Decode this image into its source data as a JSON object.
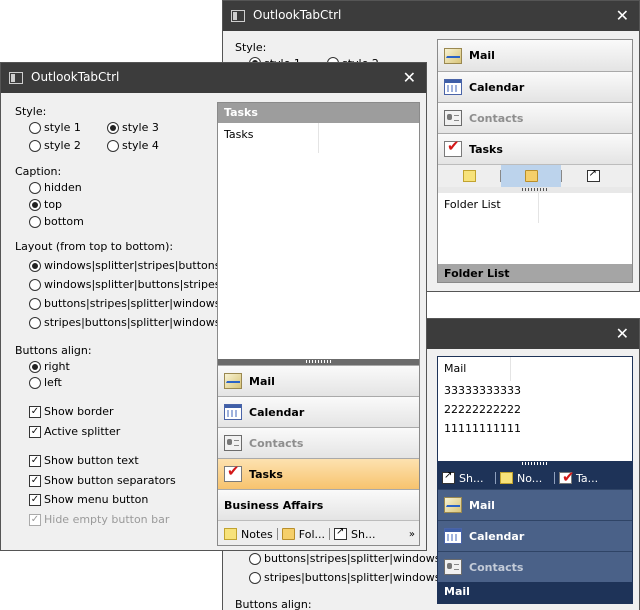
{
  "app_title": "OutlookTabCtrl",
  "icons": {
    "title": "window-icon",
    "close": "close-icon"
  },
  "window_back_top": {
    "style_label": "Style:",
    "style_row_partial": [
      "style 1",
      "style 2"
    ],
    "buttons": [
      {
        "label": "Mail",
        "icon": "mail-icon",
        "state": "normal"
      },
      {
        "label": "Calendar",
        "icon": "calendar-icon",
        "state": "normal"
      },
      {
        "label": "Contacts",
        "icon": "contacts-icon",
        "state": "disabled"
      },
      {
        "label": "Tasks",
        "icon": "tasks-icon",
        "state": "normal"
      }
    ],
    "page_text": "Folder List",
    "caption": "Folder List"
  },
  "window_back_bottom": {
    "partial_options": [
      "buttons|stripes|splitter|windows",
      "stripes|buttons|splitter|windows"
    ],
    "partial_label": "Buttons align:",
    "page_text": "Mail",
    "numbers": [
      "33333333333",
      "22222222222",
      "11111111111"
    ],
    "bar_items": [
      "Sh...",
      "No...",
      "Ta..."
    ],
    "buttons": [
      {
        "label": "Mail",
        "icon": "mail-icon",
        "state": "normal"
      },
      {
        "label": "Calendar",
        "icon": "calendar-icon",
        "state": "normal"
      },
      {
        "label": "Contacts",
        "icon": "contacts-icon",
        "state": "disabled"
      }
    ],
    "caption": "Mail"
  },
  "window_front": {
    "style_label": "Style:",
    "style_options": [
      "style 1",
      "style 3",
      "style 2",
      "style 4"
    ],
    "caption_label": "Caption:",
    "caption_options": [
      "hidden",
      "top",
      "bottom"
    ],
    "layout_label": "Layout (from top to bottom):",
    "layout_options": [
      "windows|splitter|stripes|buttons",
      "windows|splitter|buttons|stripes",
      "buttons|stripes|splitter|windows",
      "stripes|buttons|splitter|windows"
    ],
    "buttons_align_label": "Buttons align:",
    "align_options": [
      "right",
      "left"
    ],
    "checkboxes": [
      "Show border",
      "Active splitter",
      "Show button text",
      "Show button separators",
      "Show menu button",
      "Hide empty button bar"
    ],
    "ctrl": {
      "caption": "Tasks",
      "page_text": "Tasks",
      "buttons": [
        {
          "label": "Mail",
          "icon": "mail-icon",
          "state": "normal"
        },
        {
          "label": "Calendar",
          "icon": "calendar-icon",
          "state": "normal"
        },
        {
          "label": "Contacts",
          "icon": "contacts-icon",
          "state": "disabled"
        },
        {
          "label": "Tasks",
          "icon": "tasks-icon",
          "state": "active"
        },
        {
          "label": "Business Affairs",
          "icon": "",
          "state": "normal"
        }
      ],
      "bar_items": [
        "Notes",
        "Fol...",
        "Sh..."
      ],
      "menu_glyph": "»"
    }
  }
}
